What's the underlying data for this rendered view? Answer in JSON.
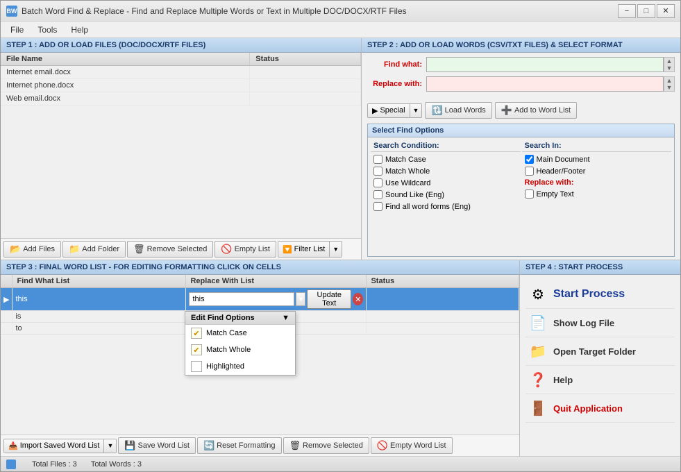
{
  "window": {
    "title": "Batch Word Find & Replace - Find and Replace Multiple Words or Text  in Multiple DOC/DOCX/RTF Files",
    "icon": "BW"
  },
  "menu": {
    "items": [
      "File",
      "Tools",
      "Help"
    ]
  },
  "step1": {
    "header": "STEP 1 : ADD OR LOAD FILES (DOC/DOCX/RTF FILES)",
    "columns": [
      "File Name",
      "Status"
    ],
    "files": [
      {
        "name": "Internet email.docx",
        "status": ""
      },
      {
        "name": "Internet phone.docx",
        "status": ""
      },
      {
        "name": "Web email.docx",
        "status": ""
      }
    ],
    "toolbar": {
      "add_files": "Add Files",
      "add_folder": "Add Folder",
      "remove_selected": "Remove Selected",
      "empty_list": "Empty List",
      "filter_list": "Filter List"
    }
  },
  "step2": {
    "header": "STEP 2 : ADD OR LOAD WORDS (CSV/TXT FILES) & SELECT FORMAT",
    "find_label": "Find what:",
    "replace_label": "Replace with:",
    "find_value": "",
    "replace_value": "",
    "toolbar": {
      "special": "Special",
      "load_words": "Load Words",
      "add_to_list": "Add to Word List"
    },
    "find_options": {
      "header": "Select Find Options",
      "search_condition": "Search Condition:",
      "search_in": "Search In:",
      "options": [
        {
          "id": "match_case",
          "label": "Match Case",
          "checked": false,
          "col": "condition"
        },
        {
          "id": "match_whole",
          "label": "Match Whole",
          "checked": false,
          "col": "condition"
        },
        {
          "id": "use_wildcard",
          "label": "Use Wildcard",
          "checked": false,
          "col": "condition"
        },
        {
          "id": "sound_like",
          "label": "Sound Like (Eng)",
          "checked": false,
          "col": "condition"
        },
        {
          "id": "find_all_forms",
          "label": "Find all word forms (Eng)",
          "checked": false,
          "col": "condition"
        },
        {
          "id": "main_doc",
          "label": "Main Document",
          "checked": true,
          "col": "search_in"
        },
        {
          "id": "header_footer",
          "label": "Header/Footer",
          "checked": false,
          "col": "search_in"
        },
        {
          "id": "empty_text",
          "label": "Empty Text",
          "checked": false,
          "col": "replace_with"
        }
      ],
      "replace_with_label": "Replace with:"
    }
  },
  "step3": {
    "header": "STEP 3 : FINAL WORD LIST - FOR EDITING FORMATTING CLICK ON CELLS",
    "columns": [
      "",
      "Find What List",
      "Replace With List",
      "Status"
    ],
    "words": [
      {
        "find": "this",
        "replace": "this",
        "status": "",
        "selected": true
      },
      {
        "find": "is",
        "replace": "",
        "status": "",
        "selected": false
      },
      {
        "find": "to",
        "replace": "",
        "status": "",
        "selected": false
      }
    ],
    "inline": {
      "current_value": "this",
      "update_btn": "Update Text"
    },
    "dropdown": {
      "header": "Edit Find Options",
      "arrow": "▼",
      "items": [
        {
          "label": "Match Case",
          "checked": true
        },
        {
          "label": "Match Whole",
          "checked": true
        },
        {
          "label": "Highlighted",
          "checked": false
        }
      ]
    },
    "toolbar": {
      "import_saved": "Import Saved Word List",
      "save_list": "Save Word List",
      "reset_formatting": "Reset Formatting",
      "remove_selected": "Remove Selected",
      "empty_word_list": "Empty Word List"
    }
  },
  "step4": {
    "header": "STEP 4 : START PROCESS",
    "items": [
      {
        "icon": "⚙",
        "label": "Start Process",
        "style": "start"
      },
      {
        "icon": "📄",
        "label": "Show Log File",
        "style": "normal"
      },
      {
        "icon": "📁",
        "label": "Open Target Folder",
        "style": "normal"
      },
      {
        "icon": "❓",
        "label": "Help",
        "style": "normal"
      },
      {
        "icon": "🚪",
        "label": "Quit Application",
        "style": "red"
      }
    ]
  },
  "status_bar": {
    "total_files": "Total Files : 3",
    "total_words": "Total Words : 3"
  }
}
